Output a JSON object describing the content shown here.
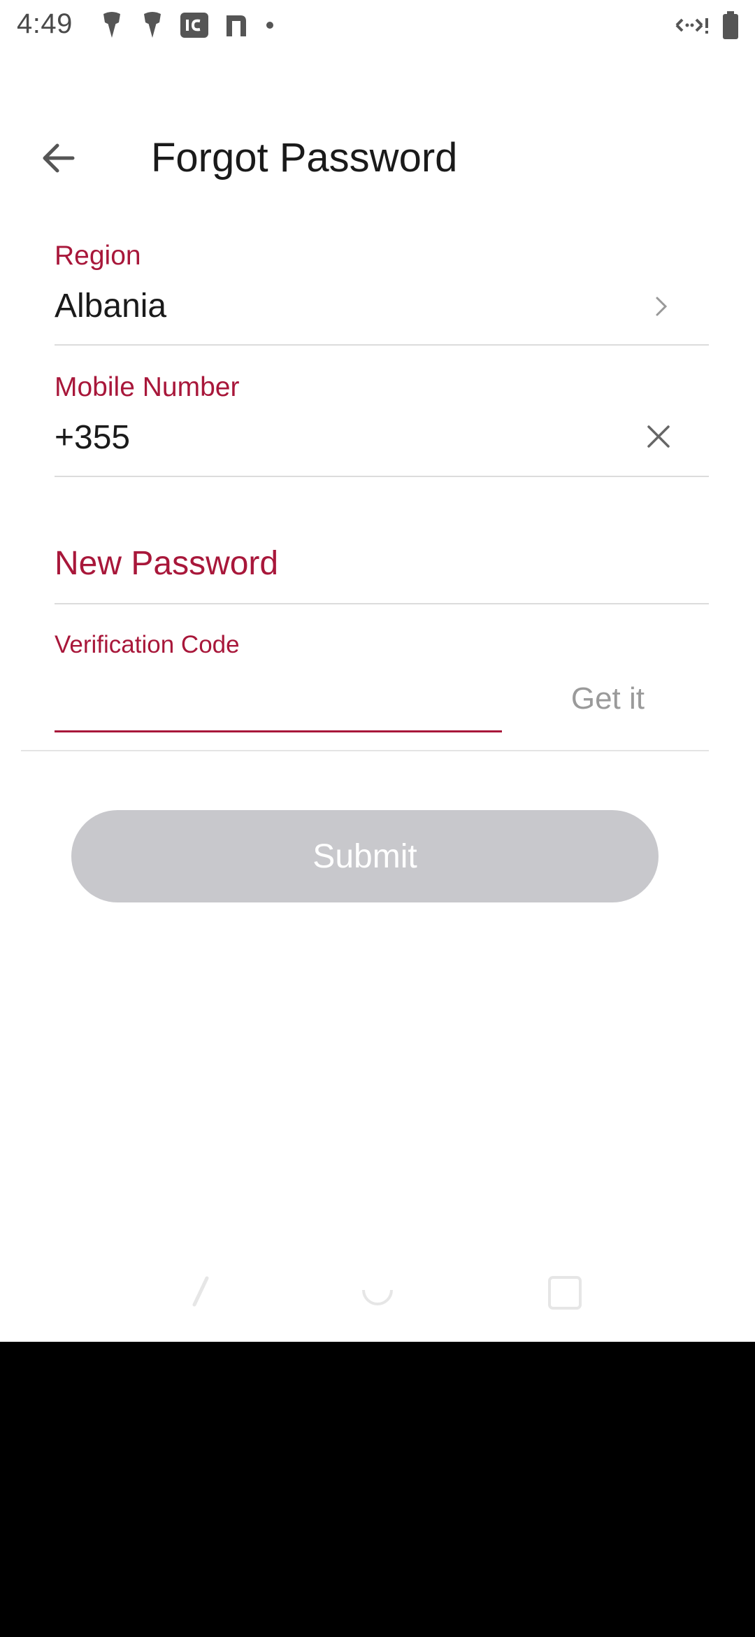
{
  "status_bar": {
    "time": "4:49",
    "icons": [
      "notification-icon",
      "notification-icon",
      "app-1c-icon",
      "app-n-icon",
      "dot-icon"
    ],
    "right_icons": [
      "data-arrows-icon",
      "battery-icon"
    ]
  },
  "header": {
    "back_icon": "arrow-left-icon",
    "title": "Forgot Password"
  },
  "form": {
    "region": {
      "label": "Region",
      "value": "Albania"
    },
    "mobile": {
      "label": "Mobile Number",
      "value": "+355"
    },
    "new_password": {
      "label": "New Password"
    },
    "verification": {
      "label": "Verification Code",
      "value": "",
      "get_code_label": "Get it"
    }
  },
  "submit_label": "Submit",
  "colors": {
    "accent": "#a8173a",
    "submit_disabled": "#c8c8cc",
    "divider": "#dcdcdc"
  },
  "nav_bar": {
    "items": [
      "back-gesture-icon",
      "home-icon",
      "recents-icon"
    ]
  }
}
